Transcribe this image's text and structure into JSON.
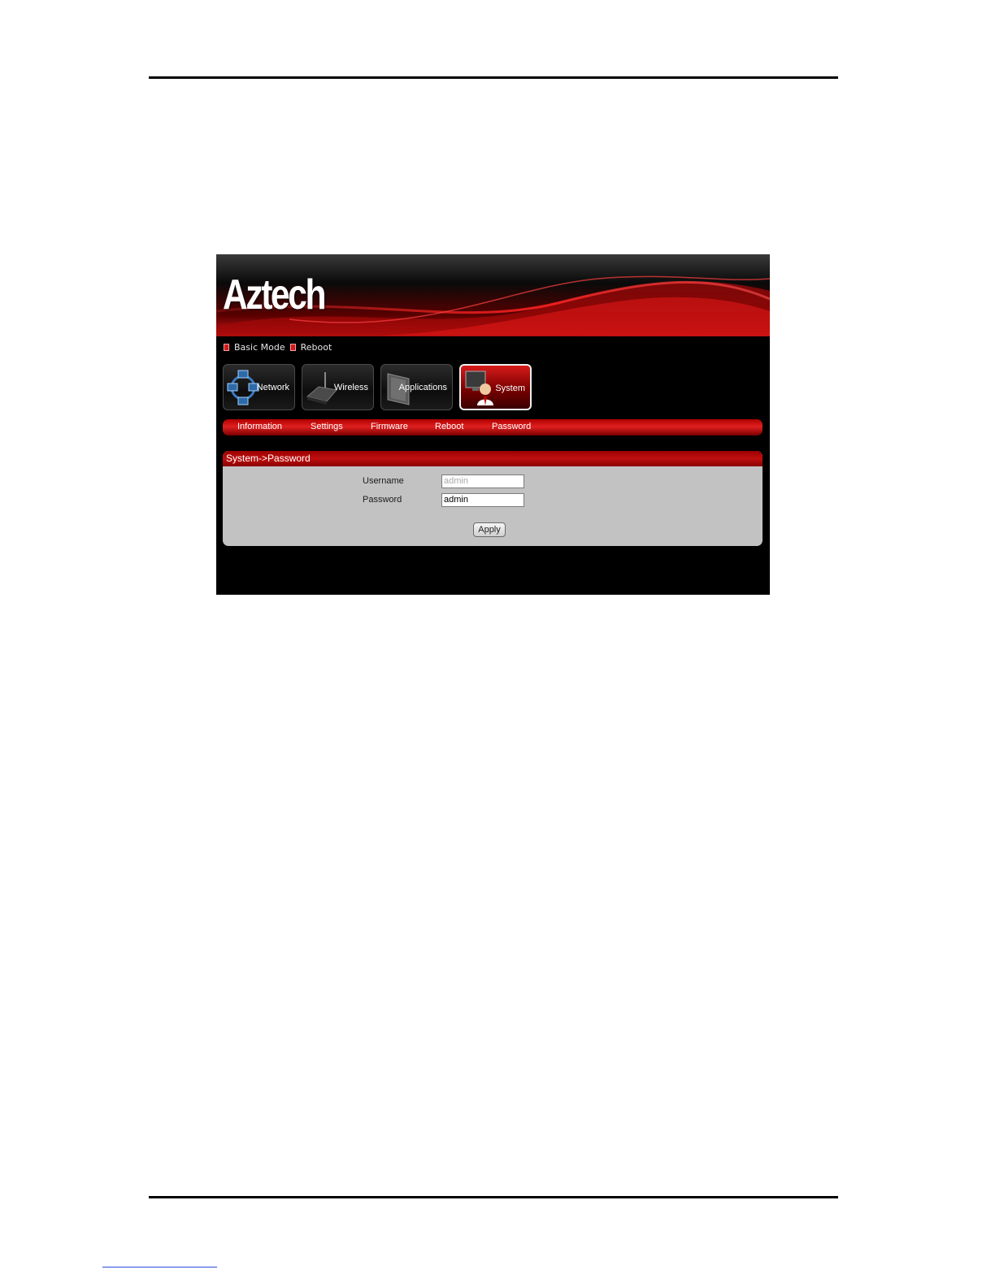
{
  "brand": {
    "logo_text": "Aztech"
  },
  "top_links": [
    {
      "label": "Basic Mode"
    },
    {
      "label": "Reboot"
    }
  ],
  "nav_buttons": [
    {
      "label": "Network",
      "icon": "network-icon",
      "active": false
    },
    {
      "label": "Wireless",
      "icon": "router-icon",
      "active": false
    },
    {
      "label": "Applications",
      "icon": "applications-icon",
      "active": false
    },
    {
      "label": "System",
      "icon": "system-user-icon",
      "active": true
    }
  ],
  "sub_nav": [
    {
      "label": "Information"
    },
    {
      "label": "Settings"
    },
    {
      "label": "Firmware"
    },
    {
      "label": "Reboot"
    },
    {
      "label": "Password"
    }
  ],
  "panel": {
    "title": "System->Password",
    "fields": [
      {
        "label": "Username",
        "value": "admin",
        "disabled": true
      },
      {
        "label": "Password",
        "value": "admin",
        "disabled": false
      }
    ],
    "apply_label": "Apply"
  },
  "colors": {
    "accent_red": "#c01010",
    "background": "#000000",
    "panel_gray": "#c2c2c2"
  }
}
